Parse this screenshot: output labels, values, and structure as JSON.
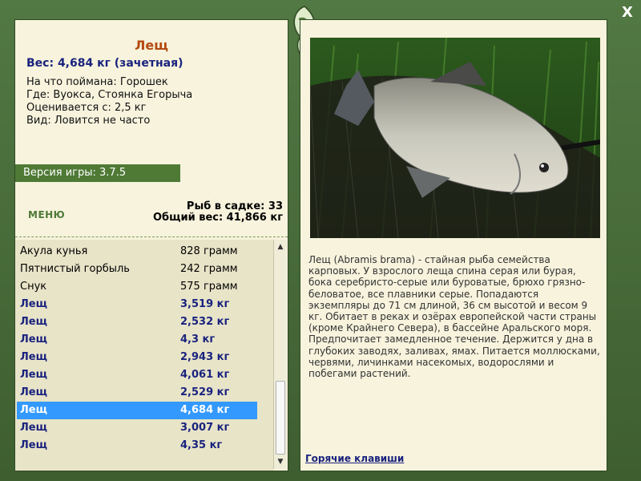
{
  "app": {
    "close_label": "X"
  },
  "catch": {
    "name": "Лещ",
    "weight": "Вес: 4,684 кг (зачетная)",
    "bait": "На что поймана: Горошек",
    "place": "Где: Вуокса, Стоянка Егорыча",
    "valued_from": "Оценивается с: 2,5 кг",
    "kind": "Вид: Ловится не часто"
  },
  "version": "Версия игры: 3.7.5",
  "menu_label": "МЕНЮ",
  "stats": {
    "fish_in_keepnet": "Рыб в садке: 33",
    "total_weight": "Общий вес: 41,866 кг"
  },
  "keepnet": [
    {
      "name": "Акула кунья",
      "weight": "828 грамм",
      "bold": false,
      "selected": false
    },
    {
      "name": "Пятнистый горбыль",
      "weight": "242 грамм",
      "bold": false,
      "selected": false
    },
    {
      "name": "Снук",
      "weight": "575 грамм",
      "bold": false,
      "selected": false
    },
    {
      "name": "Лещ",
      "weight": "3,519 кг",
      "bold": true,
      "selected": false
    },
    {
      "name": "Лещ",
      "weight": "2,532 кг",
      "bold": true,
      "selected": false
    },
    {
      "name": "Лещ",
      "weight": "4,3 кг",
      "bold": true,
      "selected": false
    },
    {
      "name": "Лещ",
      "weight": "2,943 кг",
      "bold": true,
      "selected": false
    },
    {
      "name": "Лещ",
      "weight": "4,061 кг",
      "bold": true,
      "selected": false
    },
    {
      "name": "Лещ",
      "weight": "2,529 кг",
      "bold": true,
      "selected": false
    },
    {
      "name": "Лещ",
      "weight": "4,684 кг",
      "bold": true,
      "selected": true
    },
    {
      "name": "Лещ",
      "weight": "3,007 кг",
      "bold": true,
      "selected": false
    },
    {
      "name": "Лещ",
      "weight": "4,35 кг",
      "bold": true,
      "selected": false
    }
  ],
  "description": "Лещ (Abramis brama) - стайная рыба семейства карповых. У взрослого леща спина серая или бурая, бока серебристо-серые или буроватые, брюхо грязно-беловатое, все плавники серые. Попадаются экземпляры до 71 см длиной, 36 см высотой и весом 9 кг. Обитает в реках и озёрах европейской части страны (кроме Крайнего Севера), в бассейне Аральского моря. Предпочитает замедленное течение. Держится у дна в глубоких заводях, заливах, ямах. Питается моллюсками, червями, личинками насекомых, водорослями и побегами растений.",
  "hotkeys_label": "Горячие клавиши",
  "colors": {
    "accent_green": "#4f7a36",
    "fish_name": "#b44a10",
    "bold_text": "#1a237e",
    "selection": "#3399ff"
  }
}
